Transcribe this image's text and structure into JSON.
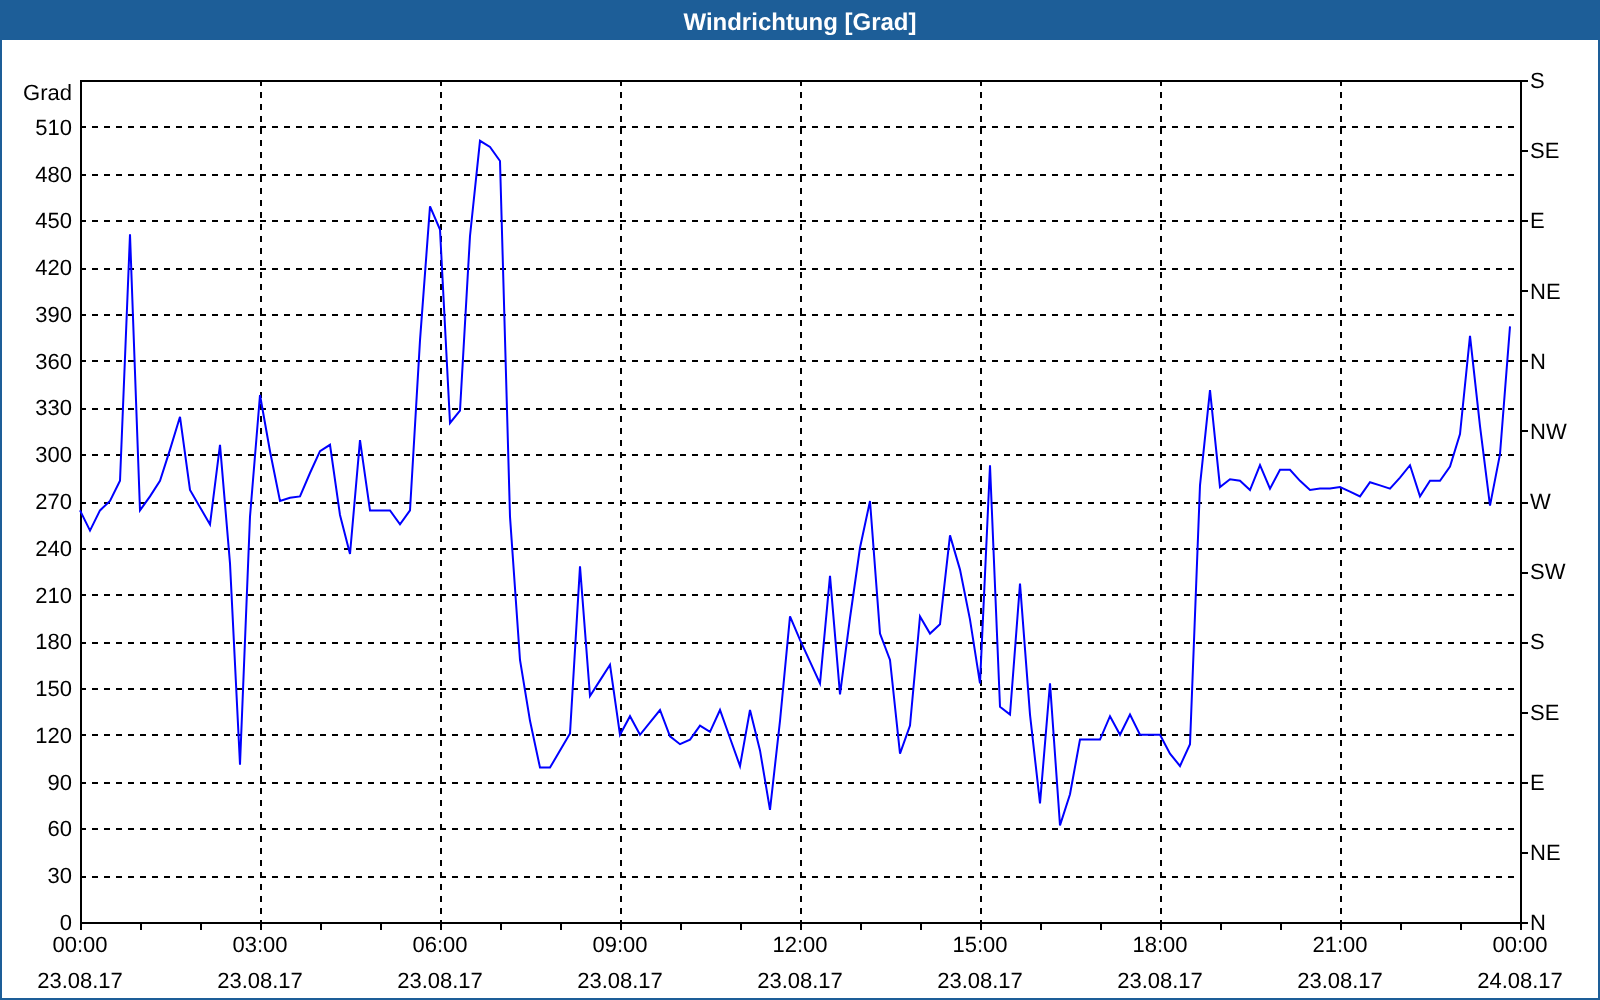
{
  "window": {
    "title": "Windrichtung [Grad]"
  },
  "chart": {
    "compass_labels": [
      "S",
      "SE",
      "E",
      "NE",
      "N",
      "NW",
      "W",
      "SW",
      "S",
      "SE",
      "E",
      "NE",
      "N"
    ],
    "chart_data": {
      "type": "line",
      "ylabel": "Grad",
      "ylim": [
        0,
        540
      ],
      "grid": true,
      "yticks": [
        0,
        30,
        60,
        90,
        120,
        150,
        180,
        210,
        240,
        270,
        300,
        330,
        360,
        390,
        420,
        450,
        480,
        510
      ],
      "categories": [
        "00:00 23.08.17",
        null,
        null,
        null,
        null,
        null,
        null,
        null,
        null,
        null,
        null,
        null,
        null,
        null,
        null,
        null,
        null,
        null,
        "03:00 23.08.17",
        null,
        null,
        null,
        null,
        null,
        null,
        null,
        null,
        null,
        null,
        null,
        null,
        null,
        null,
        null,
        null,
        null,
        "06:00 23.08.17",
        null,
        null,
        null,
        null,
        null,
        null,
        null,
        null,
        null,
        null,
        null,
        null,
        null,
        null,
        null,
        null,
        null,
        "09:00 23.08.17",
        null,
        null,
        null,
        null,
        null,
        null,
        null,
        null,
        null,
        null,
        null,
        null,
        null,
        null,
        null,
        null,
        null,
        "12:00 23.08.17",
        null,
        null,
        null,
        null,
        null,
        null,
        null,
        null,
        null,
        null,
        null,
        null,
        null,
        null,
        null,
        null,
        null,
        "15:00 23.08.17",
        null,
        null,
        null,
        null,
        null,
        null,
        null,
        null,
        null,
        null,
        null,
        null,
        null,
        null,
        null,
        null,
        null,
        "18:00 23.08.17",
        null,
        null,
        null,
        null,
        null,
        null,
        null,
        null,
        null,
        null,
        null,
        null,
        null,
        null,
        null,
        null,
        null,
        "21:00 23.08.17",
        null,
        null,
        null,
        null,
        null,
        null,
        null,
        null,
        null,
        null,
        null,
        null,
        null,
        null,
        null,
        null,
        null,
        "00:00 24.08.17"
      ],
      "series": [
        {
          "color": "#0000ff",
          "values": [
            264,
            251,
            264,
            270,
            283,
            441,
            264,
            273,
            283,
            303,
            324,
            277,
            266,
            255,
            306,
            230,
            101,
            260,
            338,
            302,
            270,
            272,
            273,
            288,
            302,
            306,
            261,
            236,
            309,
            264,
            264,
            264,
            255,
            264,
            373,
            459,
            444,
            320,
            328,
            440,
            501,
            497,
            488,
            260,
            168,
            129,
            99,
            99,
            110,
            121,
            228,
            145,
            155,
            165,
            120,
            132,
            120,
            128,
            136,
            119,
            114,
            117,
            126,
            122,
            136,
            118,
            100,
            136,
            110,
            72,
            129,
            196,
            181,
            167,
            153,
            222,
            146,
            195,
            240,
            270,
            185,
            168,
            108,
            126,
            196,
            185,
            191,
            248,
            226,
            194,
            153,
            293,
            138,
            133,
            217,
            133,
            76,
            153,
            62,
            82,
            117,
            117,
            117,
            132,
            120,
            133,
            120,
            120,
            120,
            108,
            100,
            114,
            280,
            341,
            279,
            284,
            283,
            277,
            293,
            278,
            290,
            290,
            283,
            277,
            278,
            278,
            279,
            276,
            273,
            282,
            280,
            278,
            285,
            293,
            273,
            283,
            283,
            292,
            313,
            376,
            318,
            267,
            300,
            382,
            null
          ]
        }
      ]
    }
  }
}
